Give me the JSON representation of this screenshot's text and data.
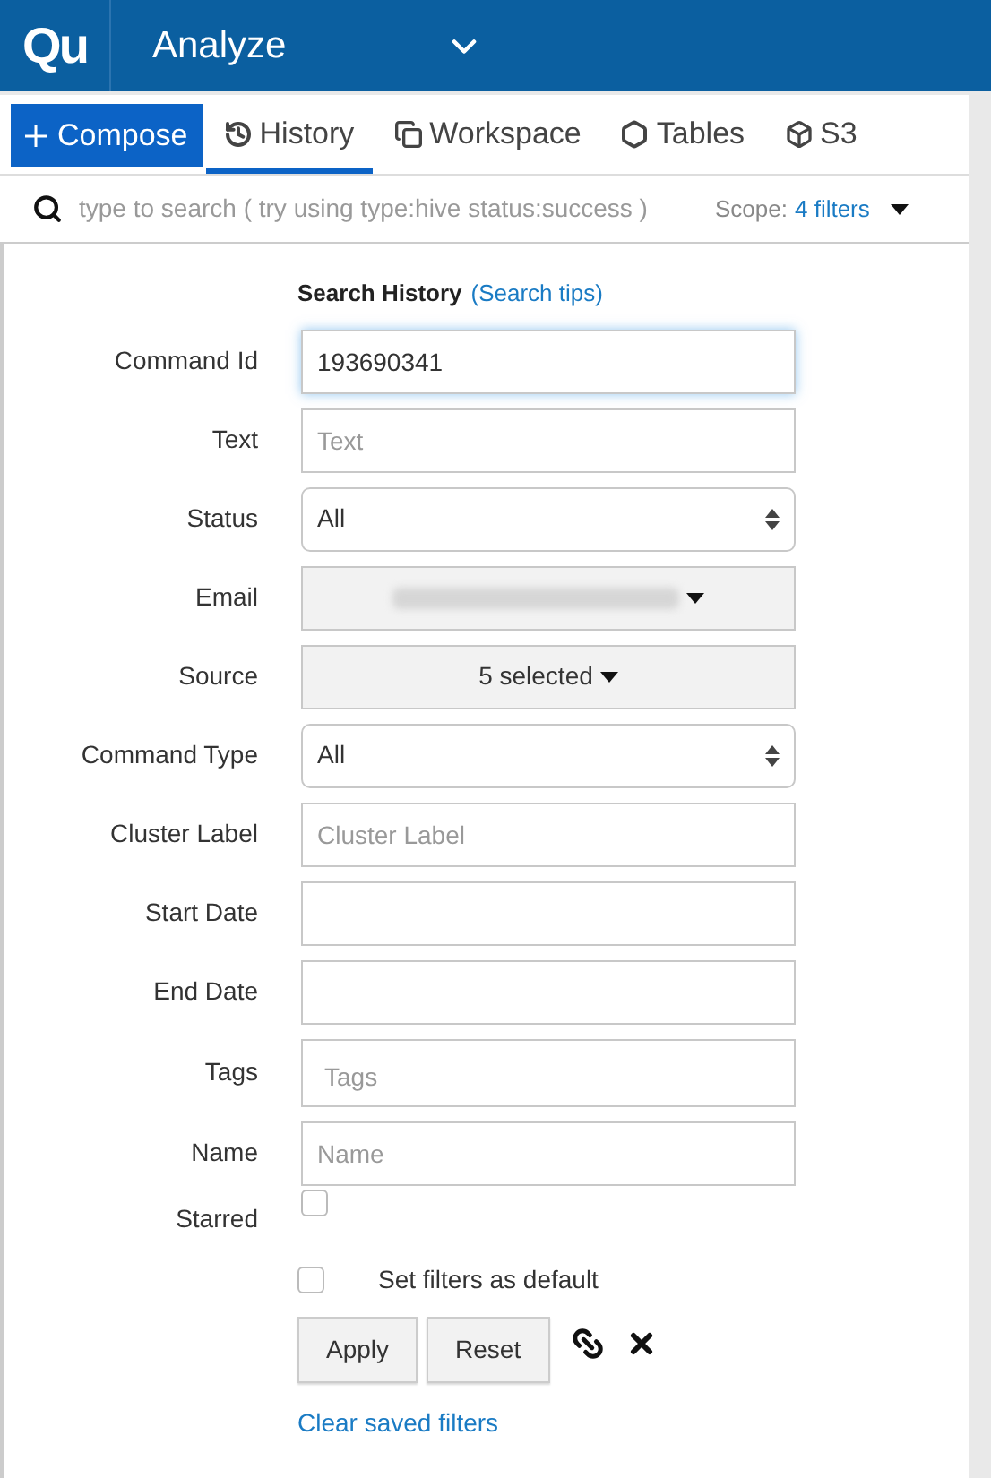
{
  "header": {
    "logo": "Qu",
    "title": "Analyze"
  },
  "tabs": [
    {
      "label": "Compose",
      "kind": "primary",
      "selected": false
    },
    {
      "label": "History",
      "kind": "history",
      "selected": true
    },
    {
      "label": "Workspace",
      "kind": "workspace",
      "selected": false
    },
    {
      "label": "Tables",
      "kind": "tables",
      "selected": false
    },
    {
      "label": "S3",
      "kind": "s3",
      "selected": false
    }
  ],
  "search": {
    "placeholder": "type to search ( try using type:hive status:success )",
    "scope_label": "Scope:",
    "scope_value": "4 filters"
  },
  "form": {
    "title": "Search History",
    "tips_link": "(Search tips)",
    "fields": [
      {
        "label": "Command Id",
        "kind": "text",
        "value": "193690341",
        "focused": true
      },
      {
        "label": "Text",
        "kind": "text",
        "placeholder": "Text",
        "focused": false
      },
      {
        "label": "Status",
        "kind": "select",
        "value": "All"
      },
      {
        "label": "Email",
        "kind": "blurred-dropdown"
      },
      {
        "label": "Source",
        "kind": "dropdown",
        "value": "5 selected"
      },
      {
        "label": "Command Type",
        "kind": "select",
        "value": "All"
      },
      {
        "label": "Cluster Label",
        "kind": "text",
        "placeholder": "Cluster Label",
        "focused": false
      },
      {
        "label": "Start Date",
        "kind": "text",
        "focused": false
      },
      {
        "label": "End Date",
        "kind": "text",
        "focused": false
      },
      {
        "label": "Tags",
        "kind": "tags",
        "placeholder": "Tags"
      },
      {
        "label": "Name",
        "kind": "text",
        "placeholder": "Name",
        "focused": false
      },
      {
        "label": "Starred",
        "kind": "checkbox",
        "checked": false
      }
    ],
    "default_checkbox": {
      "label": "Set filters as default",
      "checked": false
    },
    "buttons": [
      "Apply",
      "Reset"
    ],
    "clear_link": "Clear saved filters"
  }
}
